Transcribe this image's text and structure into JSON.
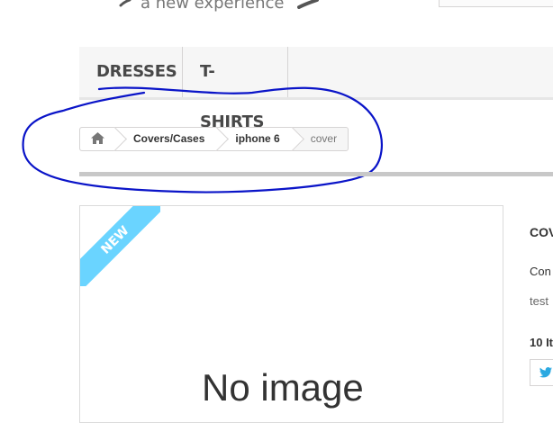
{
  "header": {
    "tagline": "a new experience"
  },
  "menu": {
    "items": [
      {
        "label": "DRESSES"
      },
      {
        "label": "T-SHIRTS"
      }
    ]
  },
  "breadcrumb": {
    "home_icon": "home-icon",
    "items": [
      {
        "label": "Covers/Cases"
      },
      {
        "label": "iphone 6"
      },
      {
        "label": "cover"
      }
    ]
  },
  "product": {
    "badge": "NEW",
    "image_placeholder": "No image",
    "title": "cov",
    "condition": "Con",
    "description": "test",
    "quantity": "10 It",
    "share_icon": "twitter-icon"
  },
  "colors": {
    "annotation": "#0a14c8",
    "ribbon": "#6ad4ff",
    "twitter": "#2ba9e1"
  }
}
